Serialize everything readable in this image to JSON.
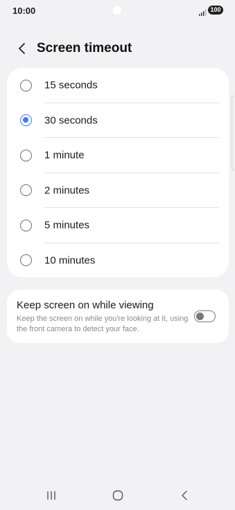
{
  "status_bar": {
    "time": "10:00",
    "battery": "100",
    "icons": [
      "signal-icon",
      "battery-icon"
    ]
  },
  "header": {
    "title": "Screen timeout",
    "back_icon": "chevron-left-icon"
  },
  "timeout_options": [
    {
      "label": "15 seconds",
      "selected": false
    },
    {
      "label": "30 seconds",
      "selected": true
    },
    {
      "label": "1 minute",
      "selected": false
    },
    {
      "label": "2 minutes",
      "selected": false
    },
    {
      "label": "5 minutes",
      "selected": false
    },
    {
      "label": "10 minutes",
      "selected": false
    }
  ],
  "keep_screen_on": {
    "title": "Keep screen on while viewing",
    "description": "Keep the screen on while you're looking at it, using the front camera to detect your face.",
    "enabled": false
  },
  "nav_bar": {
    "icons": [
      "recents-icon",
      "home-icon",
      "back-icon"
    ]
  },
  "colors": {
    "accent": "#3e7bfa",
    "background": "#f2f2f4",
    "card": "#ffffff"
  }
}
